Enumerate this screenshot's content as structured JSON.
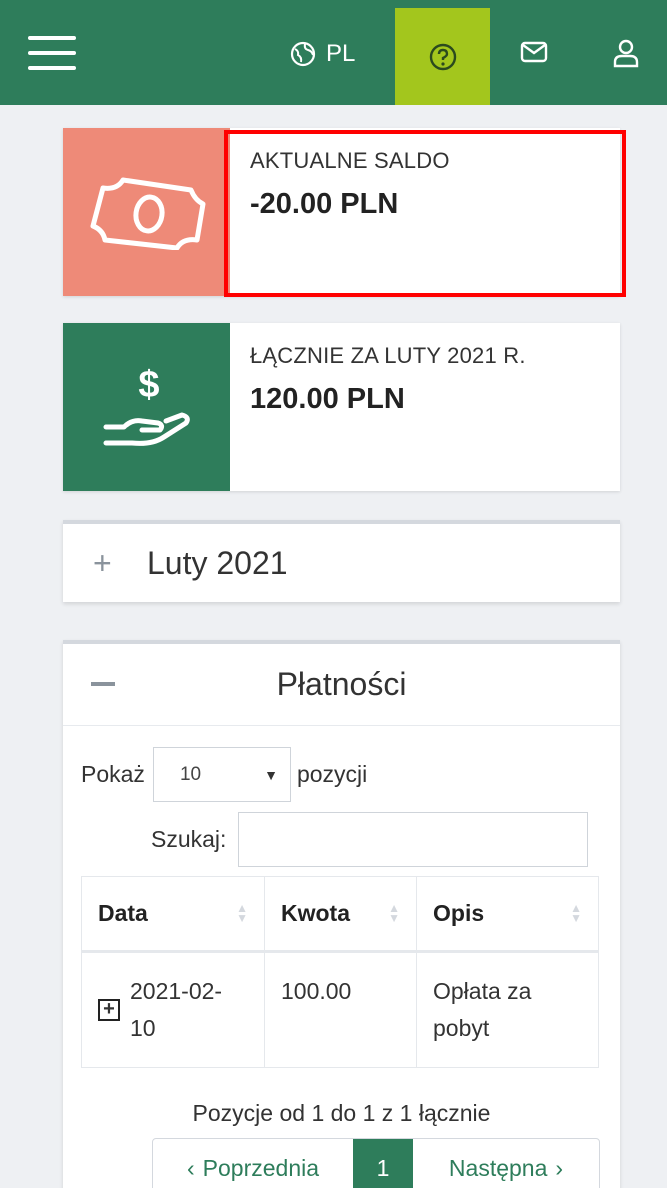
{
  "nav": {
    "lang_label": "PL"
  },
  "balance_card": {
    "label": "AKTUALNE SALDO",
    "value": "-20.00 PLN",
    "icon": "banknote-icon"
  },
  "monthly_card": {
    "label": "ŁĄCZNIE ZA LUTY 2021 R.",
    "value": "120.00 PLN",
    "icon": "hand-dollar-icon"
  },
  "month_section": {
    "toggle": "+",
    "label": "Luty 2021"
  },
  "payments": {
    "title": "Płatności",
    "show_prefix": "Pokaż",
    "page_size": "10",
    "show_suffix": "pozycji",
    "search_label": "Szukaj:",
    "search_value": "",
    "columns": [
      "Data",
      "Kwota",
      "Opis"
    ],
    "rows": [
      {
        "date": "2021-02-10",
        "date_line1": "2021-02-",
        "date_line2": "10",
        "amount": "100.00",
        "desc_line1": "Opłata za",
        "desc_line2": "pobyt"
      }
    ],
    "info": "Pozycje od 1 do 1 z 1 łącznie",
    "prev_label": "Poprzednia",
    "current_page": "1",
    "next_label": "Następna"
  },
  "colors": {
    "primary": "#2e7d5b",
    "accent": "#a3c61d",
    "balance_icon_bg": "#ee8a78",
    "highlight": "#ff0000"
  }
}
